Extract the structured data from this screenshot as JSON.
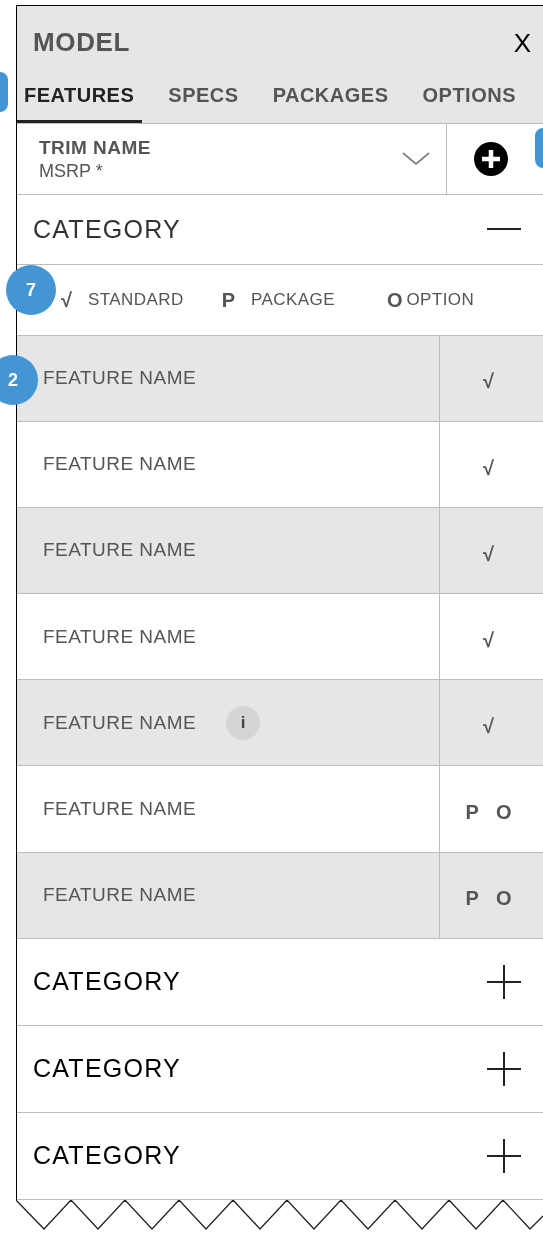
{
  "header": {
    "title": "MODEL",
    "close": "X"
  },
  "tabs": [
    {
      "label": "FEATURES",
      "selected": true
    },
    {
      "label": "SPECS",
      "selected": false
    },
    {
      "label": "PACKAGES",
      "selected": false
    },
    {
      "label": "OPTIONS",
      "selected": false
    }
  ],
  "trim": {
    "name": "TRIM NAME",
    "price": "MSRP *"
  },
  "legend": [
    {
      "symbol": "√",
      "label": "STANDARD"
    },
    {
      "symbol": "P",
      "label": "PACKAGE"
    },
    {
      "symbol": "O",
      "label": "OPTION"
    }
  ],
  "categories": [
    {
      "label": "CATEGORY",
      "expanded": true,
      "features": [
        {
          "name": "FEATURE NAME",
          "availability": "√"
        },
        {
          "name": "FEATURE NAME",
          "availability": "√"
        },
        {
          "name": "FEATURE NAME",
          "availability": "√"
        },
        {
          "name": "FEATURE NAME",
          "availability": "√"
        },
        {
          "name": "FEATURE NAME",
          "info": "i",
          "availability": "√"
        },
        {
          "name": "FEATURE NAME",
          "availability": "P O"
        },
        {
          "name": "FEATURE NAME",
          "availability": "P O"
        }
      ]
    },
    {
      "label": "CATEGORY",
      "expanded": false
    },
    {
      "label": "CATEGORY",
      "expanded": false
    },
    {
      "label": "CATEGORY",
      "expanded": false
    }
  ],
  "annotation_markers": [
    {
      "label": "7"
    },
    {
      "label": "2"
    }
  ]
}
